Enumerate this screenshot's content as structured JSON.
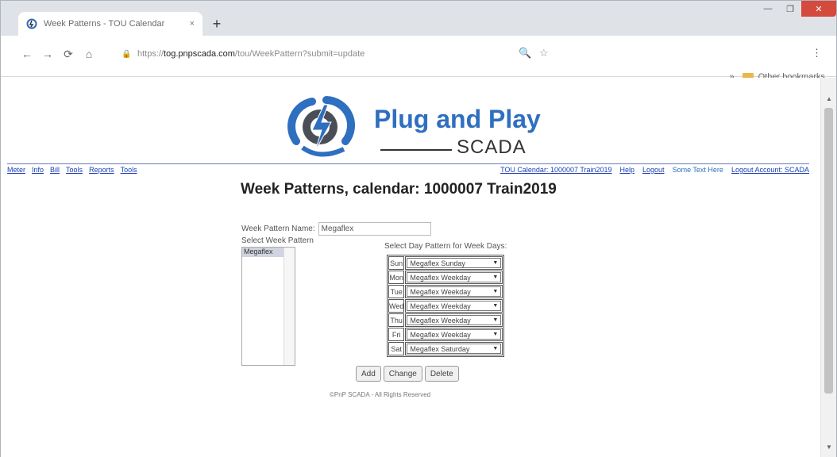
{
  "browser": {
    "tab_title": "Week Patterns - TOU Calendar",
    "tab_close": "×",
    "new_tab": "+",
    "url_prefix": "https://",
    "url_domain": "tog.pnpscada.com",
    "url_path": "/tou/WeekPattern?submit=update",
    "bookmarks_label": "Other bookmarks",
    "window_controls": {
      "minimize": "—",
      "maximize": "❐",
      "close": "✕"
    }
  },
  "header": {
    "logo_title": "Plug and Play",
    "logo_sub": "SCADA",
    "nav_left": [
      "Meter",
      "Info",
      "Bill",
      "Tools",
      "Reports",
      "Tools"
    ],
    "nav_right_main": "TOU Calendar: 1000007 Train2019",
    "nav_right": [
      "Help",
      "Logout"
    ],
    "nav_right_plain": "Some Text Here",
    "nav_right_last": "Logout Account: SCADA"
  },
  "page": {
    "title": "Week Patterns, calendar: 1000007 Train2019",
    "week_name_label": "Week Pattern Name:",
    "week_name_value": "Megaflex",
    "select_label": "Select Week Pattern",
    "list_items": [
      "Megaflex"
    ],
    "day_pattern_label": "Select Day Pattern for Week Days:",
    "days": [
      {
        "day": "Sun",
        "pattern": "Megaflex Sunday"
      },
      {
        "day": "Mon",
        "pattern": "Megaflex Weekday"
      },
      {
        "day": "Tue",
        "pattern": "Megaflex Weekday"
      },
      {
        "day": "Wed",
        "pattern": "Megaflex Weekday"
      },
      {
        "day": "Thu",
        "pattern": "Megaflex Weekday"
      },
      {
        "day": "Fri",
        "pattern": "Megaflex Weekday"
      },
      {
        "day": "Sat",
        "pattern": "Megaflex Saturday"
      }
    ],
    "buttons": {
      "add": "Add",
      "change": "Change",
      "delete": "Delete"
    },
    "footer": "©PnP SCADA - All Rights Reserved"
  }
}
